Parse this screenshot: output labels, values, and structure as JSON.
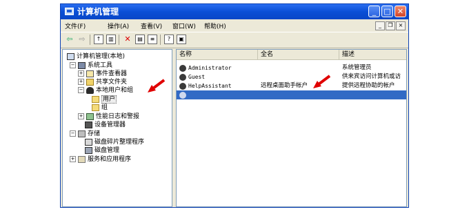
{
  "window": {
    "title": "计算机管理"
  },
  "menu": {
    "items": [
      "文件(F)",
      "操作(A)",
      "查看(V)",
      "窗口(W)",
      "帮助(H)"
    ]
  },
  "tree": {
    "root": "计算机管理(本地)",
    "system_tools": "系统工具",
    "event_viewer": "事件查看器",
    "shared_folders": "共享文件夹",
    "local_users_groups": "本地用户和组",
    "users": "用户",
    "groups": "组",
    "perf_logs": "性能日志和警报",
    "device_manager": "设备管理器",
    "storage": "存储",
    "defrag": "磁盘碎片整理程序",
    "disk_mgmt": "磁盘管理",
    "services_apps": "服务和应用程序"
  },
  "list": {
    "columns": [
      "名称",
      "全名",
      "描述"
    ],
    "rows": [
      {
        "name": "Administrator",
        "fullname": "",
        "desc": "系统管理员"
      },
      {
        "name": "Guest",
        "fullname": "",
        "desc": "供来宾访问计算机或访"
      },
      {
        "name": "HelpAssistant",
        "fullname": "远程桌面助手帐户",
        "desc": "提供远程协助的帐户"
      },
      {
        "name": "",
        "fullname": "",
        "desc": ""
      }
    ]
  },
  "colors": {
    "arrow": "#e00000",
    "selection": "#316ac5",
    "titlebar": "#0a4fd6"
  }
}
